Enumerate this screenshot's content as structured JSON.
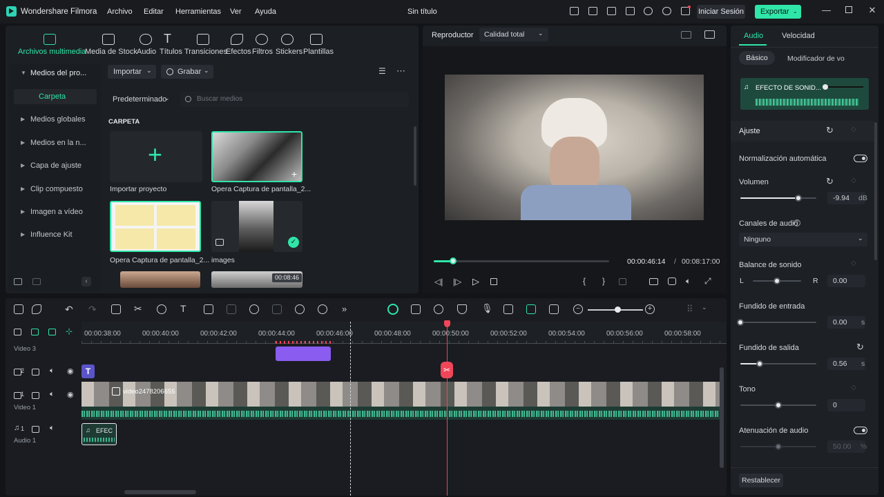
{
  "app": {
    "name": "Wondershare Filmora",
    "doc_title": "Sin título"
  },
  "menu": [
    "Archivo",
    "Editar",
    "Herramientas",
    "Ver",
    "Ayuda"
  ],
  "header": {
    "login": "Iniciar Sesión",
    "export": "Exportar"
  },
  "tabs": [
    {
      "label": "Archivos multimedia",
      "icon": "media-icon"
    },
    {
      "label": "Media de Stock",
      "icon": "stock-icon"
    },
    {
      "label": "Audio",
      "icon": "music-icon"
    },
    {
      "label": "Títulos",
      "icon": "text-icon"
    },
    {
      "label": "Transiciones",
      "icon": "transition-icon"
    },
    {
      "label": "Efectos",
      "icon": "effects-icon"
    },
    {
      "label": "Filtros",
      "icon": "filter-icon"
    },
    {
      "label": "Stickers",
      "icon": "sticker-icon"
    },
    {
      "label": "Plantillas",
      "icon": "template-icon"
    }
  ],
  "sidebar": {
    "project_media": "Medios del pro...",
    "folder": "Carpeta",
    "items": [
      "Medios globales",
      "Medios en la n...",
      "Capa de ajuste",
      "Clip compuesto",
      "Imagen a vídeo",
      "Influence Kit"
    ]
  },
  "media": {
    "import": "Importar",
    "record": "Grabar",
    "sort": "Predeterminado",
    "search_placeholder": "Buscar medios",
    "folder_heading": "CARPETA",
    "items": [
      {
        "label": "Importar proyecto"
      },
      {
        "label": "Opera Captura de pantalla_2..."
      },
      {
        "label": "Opera Captura de pantalla_2..."
      },
      {
        "label": "images"
      },
      {
        "label": ""
      },
      {
        "label": "",
        "duration": "00:08:46"
      }
    ]
  },
  "player": {
    "label": "Reproductor",
    "quality": "Calidad total",
    "current_time": "00:00:46:14",
    "total_time": "00:08:17:00",
    "progress": 0.11
  },
  "timeline": {
    "ruler": [
      "00:00:38:00",
      "00:00:40:00",
      "00:00:42:00",
      "00:00:44:00",
      "00:00:46:00",
      "00:00:48:00",
      "00:00:50:00",
      "00:00:52:00",
      "00:00:54:00",
      "00:00:56:00",
      "00:00:58:00"
    ],
    "tracks": [
      {
        "name": "Video 3"
      },
      {
        "name": "",
        "index": "2"
      },
      {
        "name": "Video 1",
        "index": "1"
      },
      {
        "name": "Audio 1",
        "index": "1"
      }
    ],
    "video_clip_label": "video2478206655",
    "audio_clip_label": "EFEC"
  },
  "props": {
    "tabs": [
      "Audio",
      "Velocidad"
    ],
    "subtabs": [
      "Básico",
      "Modificador de vo"
    ],
    "sound_effect": "EFECTO DE SONID...",
    "section": "Ajuste",
    "normalization": "Normalización automática",
    "volume": {
      "label": "Volumen",
      "value": "-9.94",
      "unit": "dB",
      "level": 0.76
    },
    "channels": {
      "label": "Canales de audio",
      "value": "Ninguno"
    },
    "balance": {
      "label": "Balance de sonido",
      "left": "L",
      "right": "R",
      "value": "0.00",
      "level": 0.5
    },
    "fade_in": {
      "label": "Fundido de entrada",
      "value": "0.00",
      "unit": "s",
      "level": 0.0
    },
    "fade_out": {
      "label": "Fundido  de salida",
      "value": "0.56",
      "unit": "s",
      "level": 0.25
    },
    "tone": {
      "label": "Tono",
      "value": "0",
      "level": 0.5
    },
    "attenuation": {
      "label": "Atenuación de audio",
      "value": "50.00",
      "unit": "%",
      "level": 0.5
    },
    "reset": "Restablecer"
  },
  "colors": {
    "accent": "#2fe6a8",
    "playhead": "#f0465a",
    "title_clip": "#8a5cf0"
  }
}
